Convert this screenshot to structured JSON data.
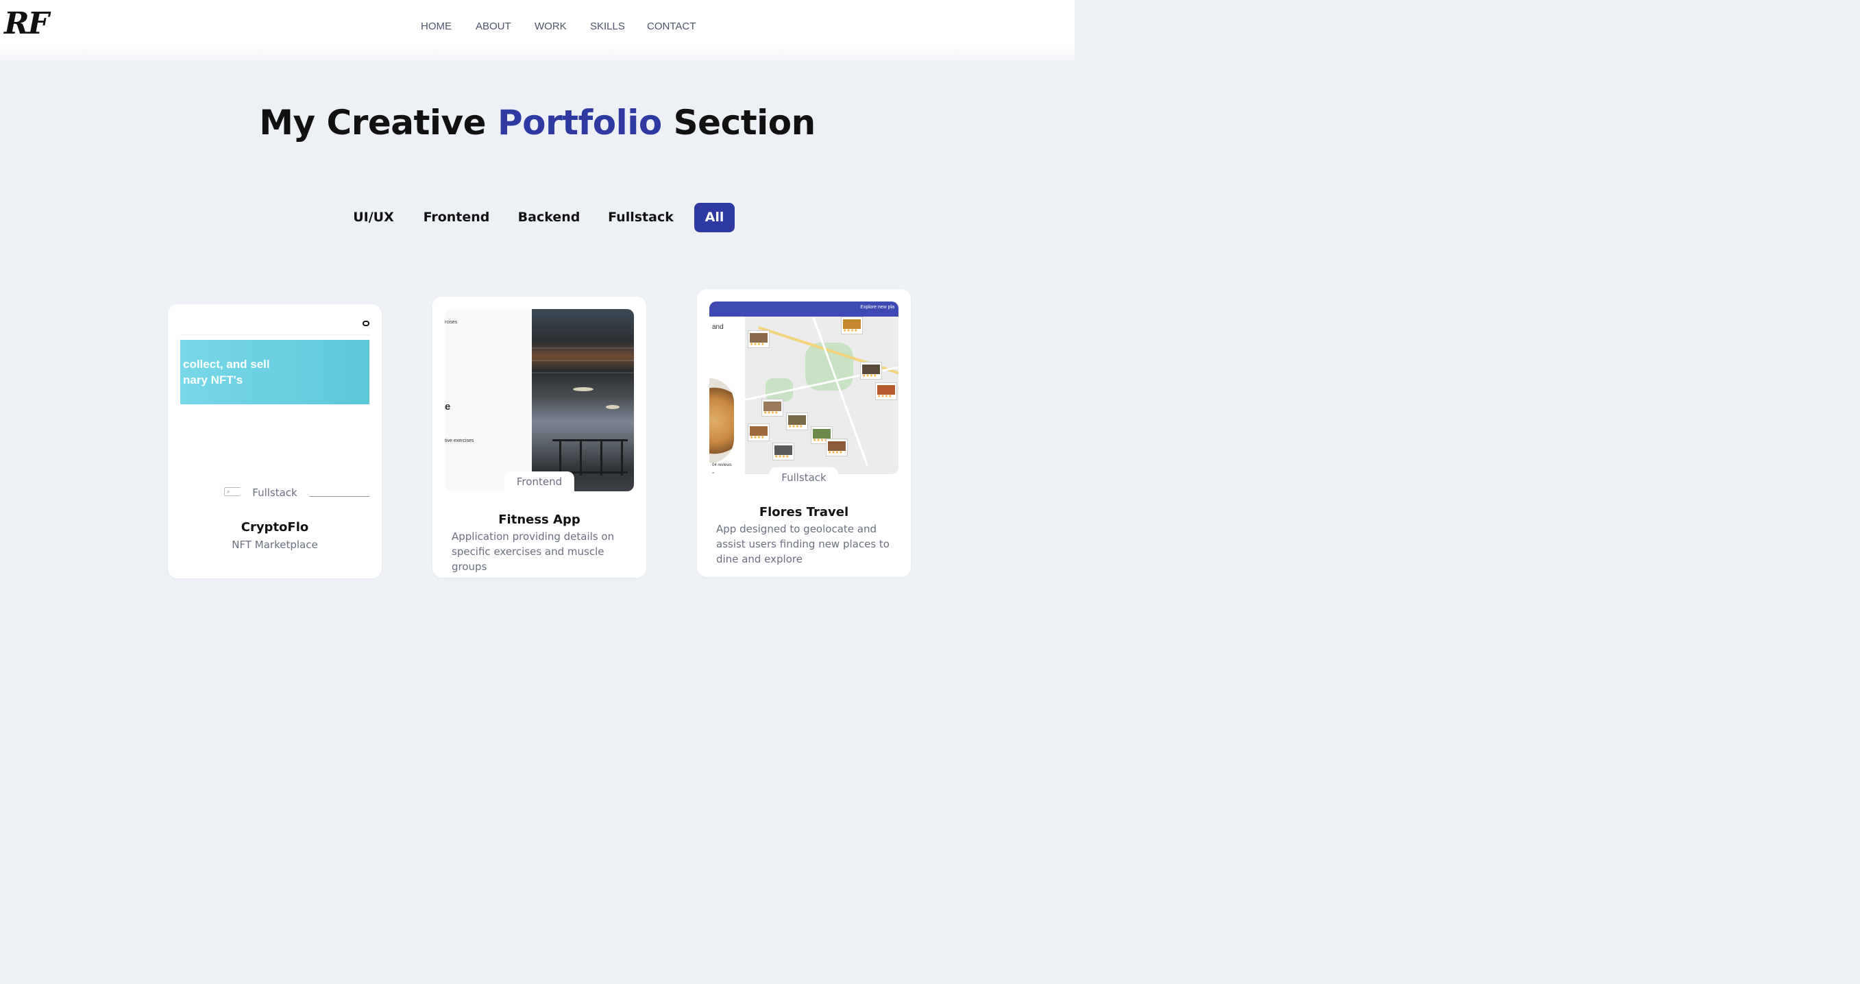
{
  "header": {
    "logo": "RF",
    "nav": [
      "HOME",
      "ABOUT",
      "WORK",
      "SKILLS",
      "CONTACT"
    ]
  },
  "hero": {
    "title_before": "My Creative ",
    "title_accent": "Portfolio",
    "title_after": " Section"
  },
  "filters": {
    "items": [
      "UI/UX",
      "Frontend",
      "Backend",
      "Fullstack",
      "All"
    ],
    "active": "All"
  },
  "colors": {
    "accent": "#2e3aa1",
    "background": "#edf0f5"
  },
  "projects": [
    {
      "tag": "Fullstack",
      "title": "CryptoFlo",
      "description": "NFT Marketplace",
      "thumb_text": [
        "collect, and sell",
        "nary NFT's"
      ]
    },
    {
      "tag": "Frontend",
      "title": "Fitness App",
      "description": "Application providing details on specific exercises and muscle groups",
      "thumb_text": [
        "rcises",
        "e",
        "tive exercises"
      ]
    },
    {
      "tag": "Fullstack",
      "title": "Flores Travel",
      "description": "App designed to geolocate and assist users finding new places to dine and explore",
      "thumb_text": [
        "Explore new pla",
        "and",
        "04 reviews",
        "$"
      ]
    }
  ]
}
